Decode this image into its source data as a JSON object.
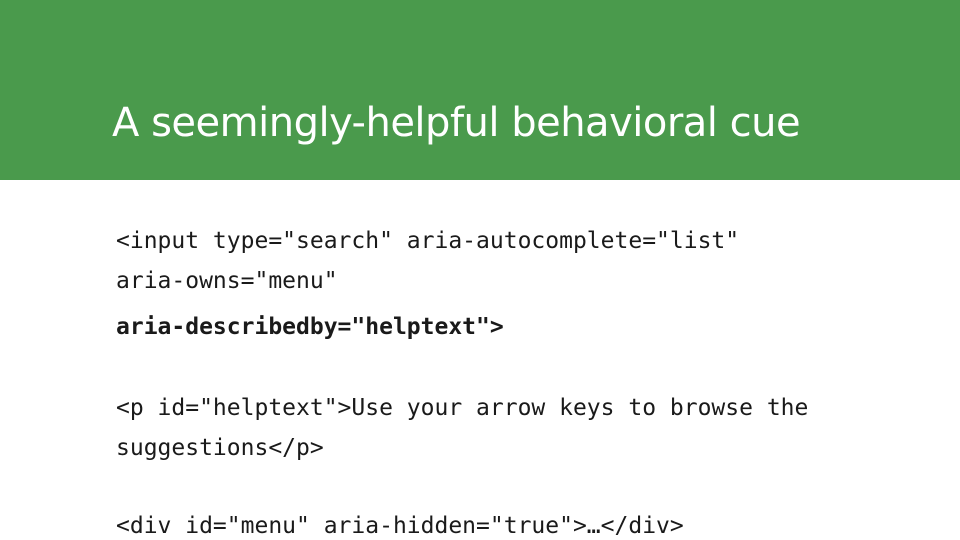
{
  "slide": {
    "title": "A seemingly-helpful behavioral cue",
    "colors": {
      "header_bg": "#4a9a4c",
      "title_text": "#ffffff",
      "code_text": "#1a1a1a",
      "background": "#ffffff"
    },
    "code_lines": [
      "<input type=\"search\" aria-autocomplete=\"list\"",
      "aria-owns=\"menu\"",
      "aria-describedby=\"helptext\">",
      "<p id=\"helptext\">Use your arrow keys to browse the",
      "suggestions</p>",
      "<div id=\"menu\" aria-hidden=\"true\">…</div>"
    ]
  }
}
